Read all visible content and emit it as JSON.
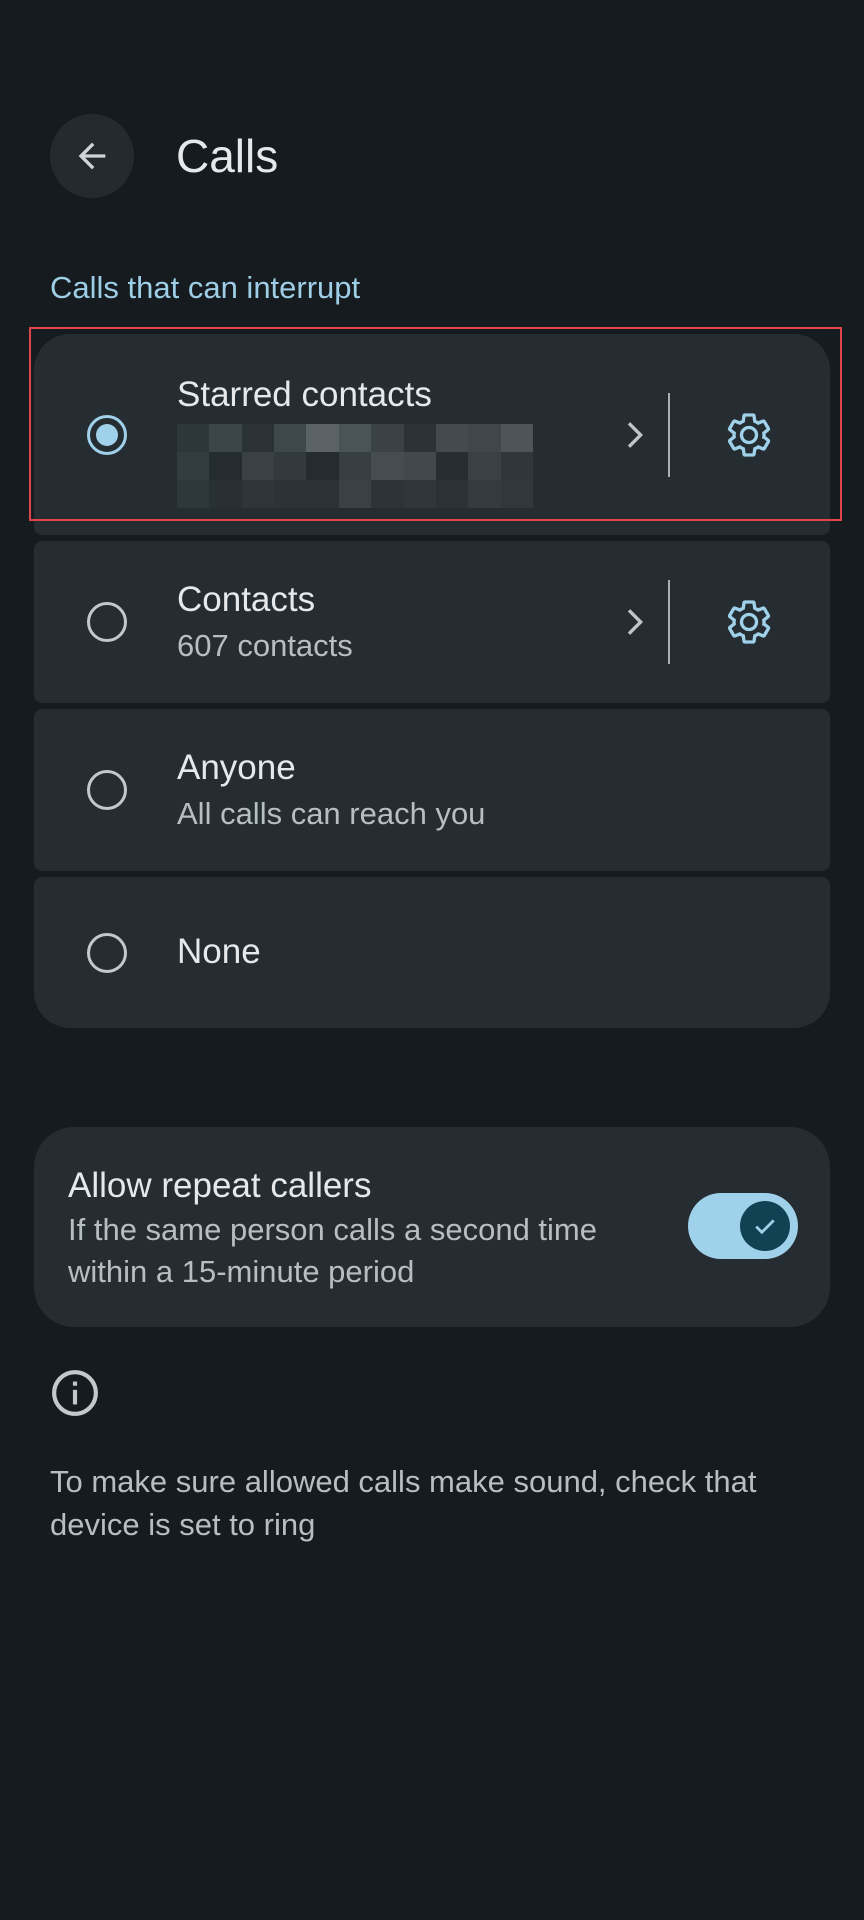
{
  "header": {
    "title": "Calls"
  },
  "section": {
    "header": "Calls that can interrupt"
  },
  "options": [
    {
      "title": "Starred contacts",
      "subtitle": "",
      "selected": true
    },
    {
      "title": "Contacts",
      "subtitle": "607 contacts",
      "selected": false
    },
    {
      "title": "Anyone",
      "subtitle": "All calls can reach you",
      "selected": false
    },
    {
      "title": "None",
      "subtitle": "",
      "selected": false
    }
  ],
  "repeat_callers": {
    "title": "Allow repeat callers",
    "description": "If the same person calls a second time within a 15-minute period",
    "enabled": true
  },
  "footer": {
    "text": "To make sure allowed calls make sound, check that device is set to ring"
  },
  "colors": {
    "background": "#151b1e",
    "card": "#252d32",
    "accent": "#9fd2ea",
    "highlight": "#e0454b"
  },
  "icons": [
    "arrow-back-icon",
    "chevron-right-icon",
    "gear-icon",
    "check-icon",
    "info-icon"
  ]
}
